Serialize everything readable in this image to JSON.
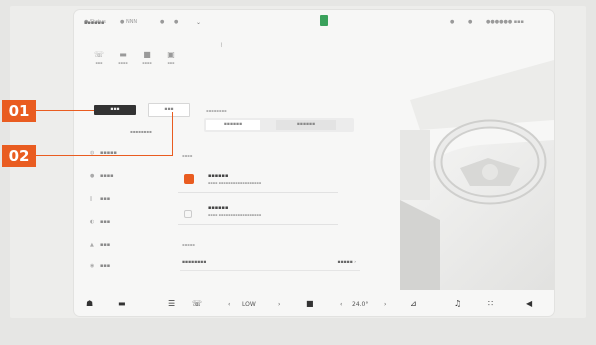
{
  "status_bar": {
    "left": [
      "● Status",
      "● NNN",
      "●",
      "●"
    ],
    "right": [
      "●",
      "●",
      "●●●●●● ▪▪▪"
    ]
  },
  "panel": {
    "selector_value": "▪▪▪▪▪▪",
    "shortcuts": [
      {
        "icon": "phone-icon",
        "glyph": "☏",
        "label": "▪▪▪"
      },
      {
        "icon": "car-icon",
        "glyph": "▬",
        "label": "▪▪▪▪"
      },
      {
        "icon": "screen-icon",
        "glyph": "■",
        "label": "▪▪▪▪"
      },
      {
        "icon": "seat-icon",
        "glyph": "▣",
        "label": "▪▪▪"
      }
    ],
    "btn_dark": "▪▪▪",
    "btn_light": "▪▪▪",
    "sub_label": "▪▪▪▪▪▪▪▪",
    "nav": [
      {
        "glyph": "◍",
        "label": "▪▪▪▪▪"
      },
      {
        "glyph": "●",
        "label": "▪▪▪▪"
      },
      {
        "glyph": "∥",
        "label": "▪▪▪"
      },
      {
        "glyph": "◐",
        "label": "▪▪▪"
      },
      {
        "glyph": "▲",
        "label": "▪▪▪"
      },
      {
        "glyph": "◉",
        "label": "▪▪▪"
      }
    ]
  },
  "content": {
    "tabs": [
      "▪▪▪▪▪▪",
      "▪▪▪▪▪▪"
    ],
    "tab_caption": "▪▪▪▪▪▪▪▪",
    "section_caption": "▪▪▪▪",
    "cards": [
      {
        "title": "▪▪▪▪▪▪",
        "desc": "▪▪▪▪ ▪▪▪▪▪▪▪▪▪▪▪▪▪▪▪▪▪▪",
        "accent": "#e95c20"
      },
      {
        "title": "▪▪▪▪▪▪",
        "desc": "▪▪▪▪ ▪▪▪▪▪▪▪▪▪▪▪▪▪▪▪▪▪▪",
        "accent": "#c8c8c8"
      }
    ],
    "row_caption": "▪▪▪▪▪",
    "row": {
      "left": "▪▪▪▪▪▪▪▪",
      "right": "▪▪▪▪▪ ›"
    }
  },
  "dock": {
    "fan": "LOW",
    "temperature": "24.0°"
  },
  "callouts": [
    "01",
    "02"
  ],
  "colors": {
    "accent": "#e95c20",
    "screen": "#f7f7f6"
  }
}
